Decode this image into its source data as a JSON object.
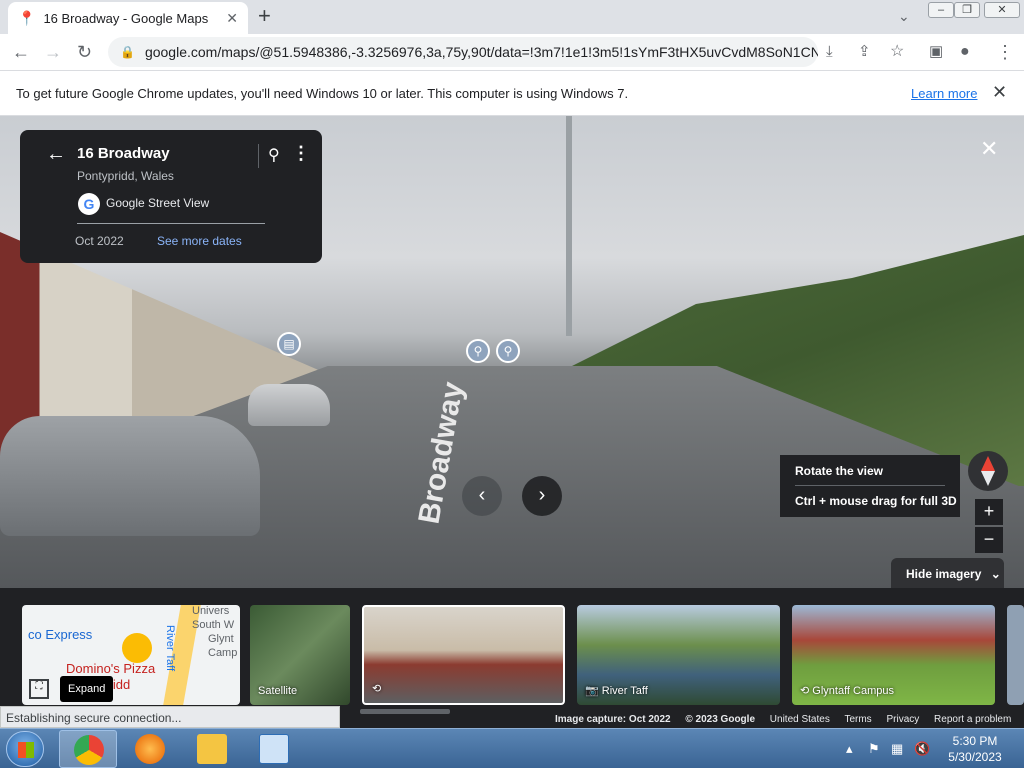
{
  "browser": {
    "tab_title": "16 Broadway - Google Maps",
    "url": "google.com/maps/@51.5948386,-3.3256976,3a,75y,90t/data=!3m7!1e1!3m5!1sYmF3tHX5uvCvdM8SoN1CN...",
    "window_buttons": [
      "–",
      "❐",
      "✕"
    ]
  },
  "infobar": {
    "message": "To get future Google Chrome updates, you'll need Windows 10 or later. This computer is using Windows 7.",
    "learn_more": "Learn more"
  },
  "streetview": {
    "road_text": "Broadway"
  },
  "infocard": {
    "title": "16 Broadway",
    "location": "Pontypridd, Wales",
    "source": "Google Street View",
    "date": "Oct 2022",
    "see_more_dates": "See more dates"
  },
  "tooltip": {
    "line1": "Rotate the view",
    "line2": "Ctrl + mouse drag for full 3D"
  },
  "controls": {
    "hide_imagery": "Hide imagery",
    "zoom_in": "+",
    "zoom_out": "−",
    "expand": "Expand"
  },
  "minimap": {
    "express": "co Express",
    "dominos": "Domino's Pizza",
    "ntypridd": "ntypridd",
    "univ": "Univers",
    "south": "South W",
    "glynt": "Glynt",
    "camp": "Camp",
    "river": "River Taff"
  },
  "thumbnails": {
    "satellite": "Satellite",
    "river_taff": "River Taff",
    "glyntaff": "Glyntaff Campus"
  },
  "footer": {
    "capture": "Image capture: Oct 2022",
    "copyright": "© 2023 Google",
    "country": "United States",
    "terms": "Terms",
    "privacy": "Privacy",
    "report": "Report a problem"
  },
  "status": "Establishing secure connection...",
  "taskbar": {
    "time": "5:30 PM",
    "date": "5/30/2023"
  }
}
